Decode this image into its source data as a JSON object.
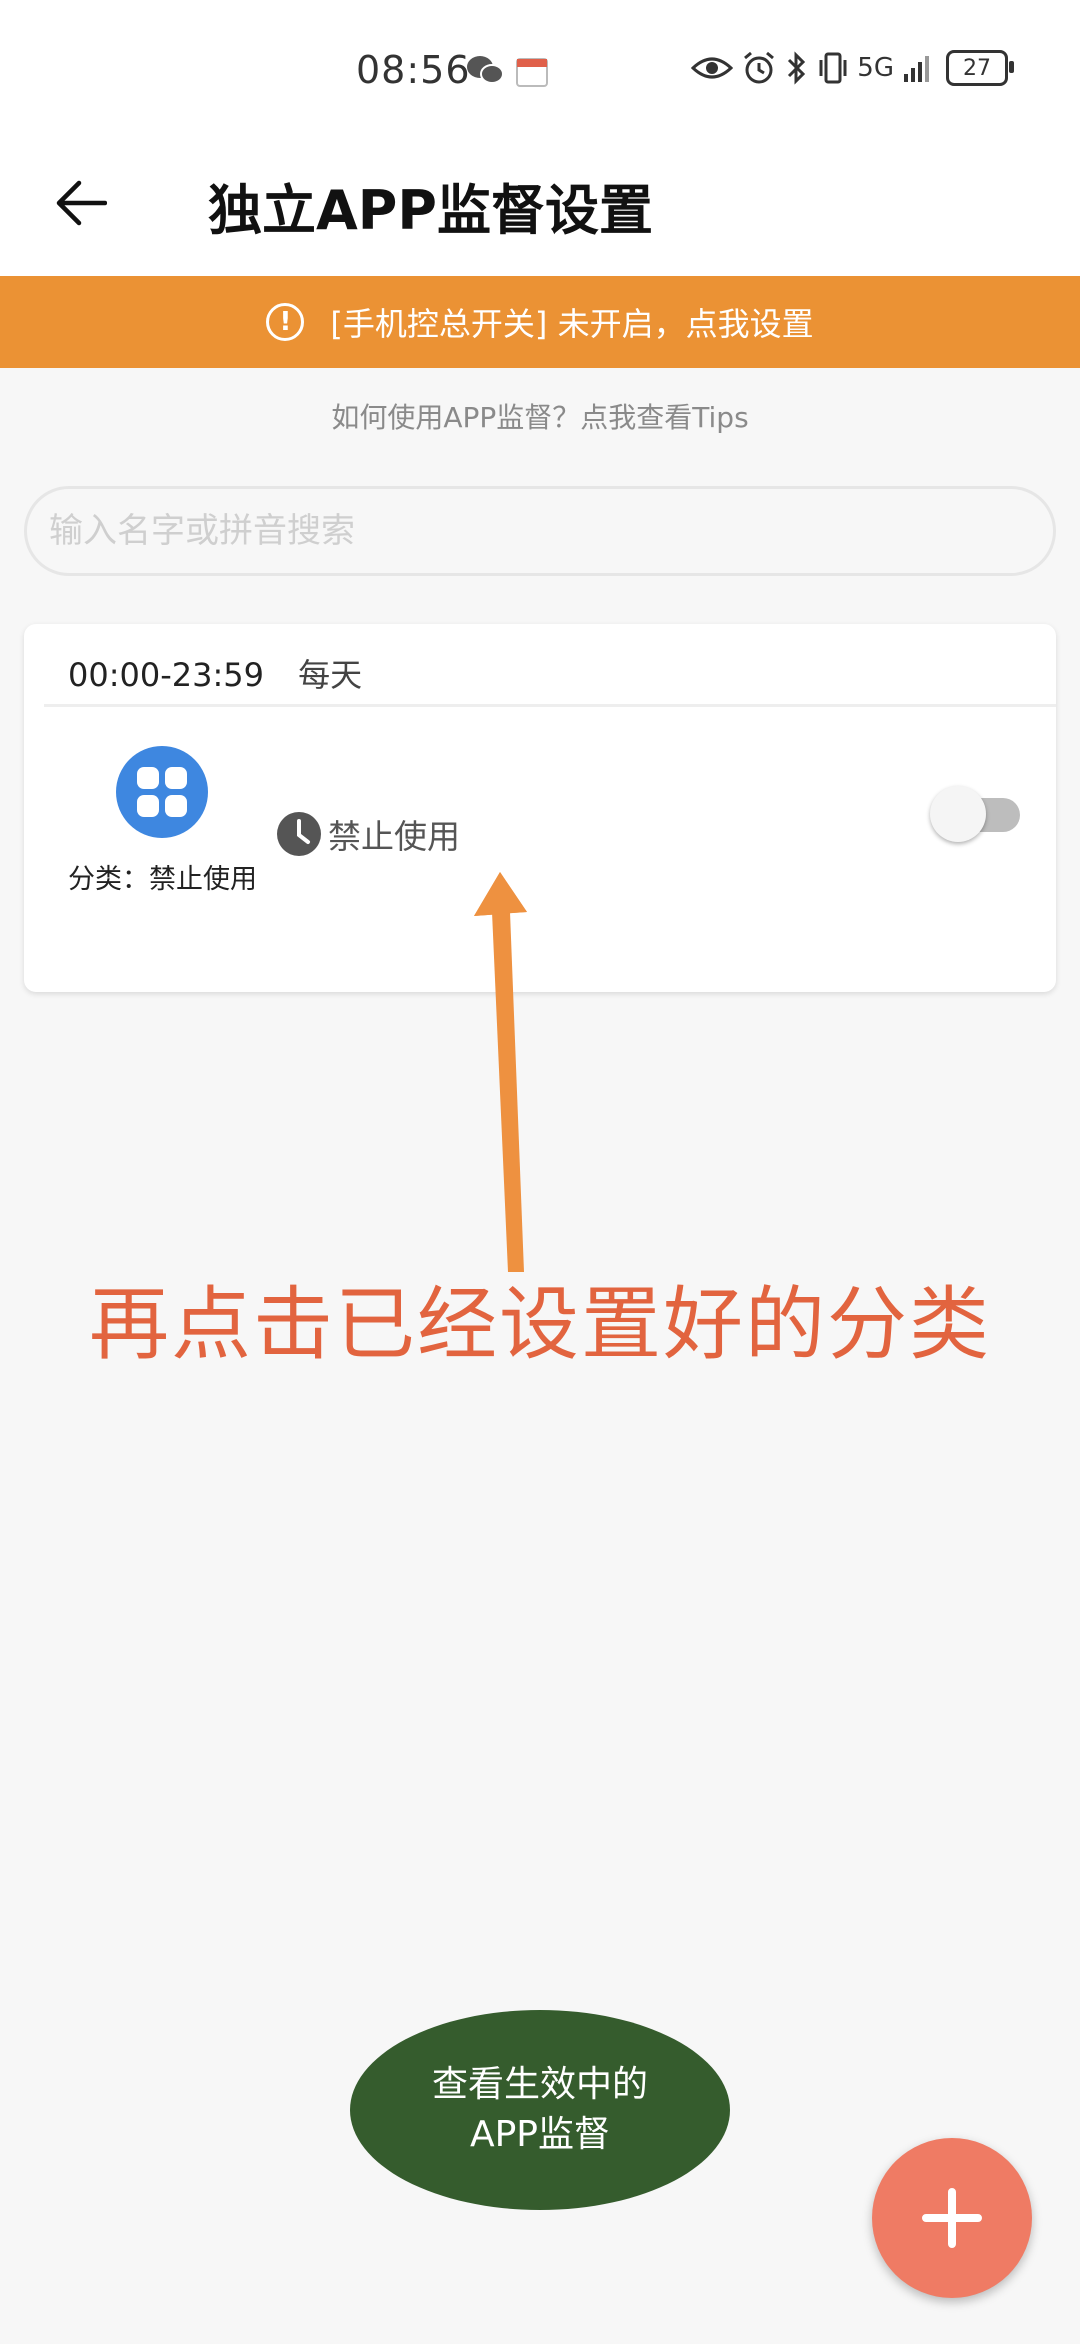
{
  "status_bar": {
    "time": "08:56",
    "network": "5G",
    "battery": "27"
  },
  "header": {
    "title": "独立APP监督设置"
  },
  "banner": {
    "text": "[手机控总开关] 未开启，点我设置"
  },
  "tips": {
    "text": "如何使用APP监督？点我查看Tips"
  },
  "search": {
    "placeholder": "输入名字或拼音搜索"
  },
  "card": {
    "time_range": "00:00-23:59",
    "day": "每天",
    "category_label": "分类：禁止使用",
    "mode": "禁止使用"
  },
  "annotation": {
    "text": "再点击已经设置好的分类"
  },
  "bubble": {
    "line1": "查看生效中的",
    "line2": "APP监督"
  },
  "colors": {
    "banner": "#eb9234",
    "category_icon": "#3e87e0",
    "annotation": "#e2643f",
    "bubble": "#355c2d",
    "fab": "#ef7b64"
  }
}
